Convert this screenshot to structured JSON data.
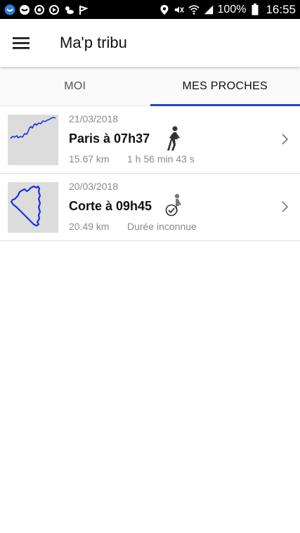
{
  "status_bar": {
    "battery_pct": "100%",
    "time": "16:55"
  },
  "app_bar": {
    "title": "Ma'p tribu"
  },
  "tabs": [
    {
      "label": "MOI",
      "active": false
    },
    {
      "label": "MES PROCHES",
      "active": true
    }
  ],
  "trips": [
    {
      "date": "21/03/2018",
      "name": "Paris à 07h37",
      "distance": "15.67 km",
      "duration": "1 h 56 min 43 s",
      "activity_icon": "walking-icon"
    },
    {
      "date": "20/03/2018",
      "name": "Corte à 09h45",
      "distance": "20.49 km",
      "duration": "Durée inconnue",
      "activity_icon": "walking-check-icon"
    }
  ],
  "colors": {
    "accent": "#2643d8",
    "route": "#1a2fe0",
    "status_bar_bg": "#000000"
  }
}
